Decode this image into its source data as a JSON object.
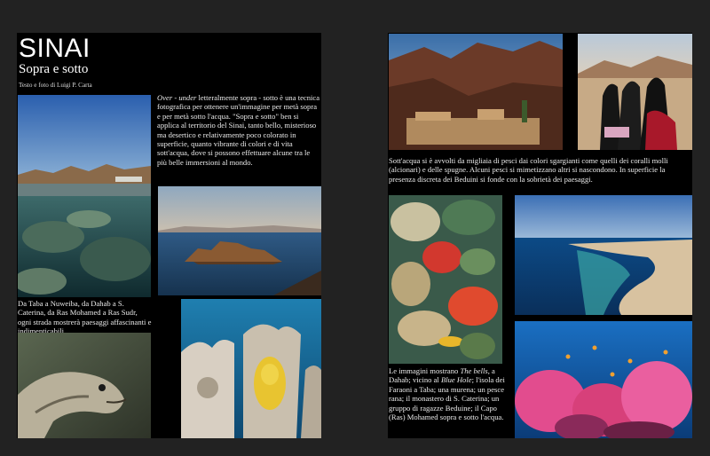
{
  "left_page": {
    "title": "SINAI",
    "subtitle": "Sopra e sotto",
    "byline": "Testo e foto di Luigi P. Carta",
    "intro_italic": "Over - under",
    "intro_text": " letteralmente sopra - sotto è una tecnica fotografica per ottenere un'immagine per metà sopra e per metà sotto l'acqua. \"Sopra e sotto\" ben si applica al territorio del Sinai, tanto bello, misterioso ma desertico e relativamente poco colorato in superficie, quanto vibrante di colori e di vita sott'acqua, dove si possono effettuare alcune tra le più belle immersioni al mondo.",
    "caption": "Da Taba a Nuweiba, da Dahab a S. Caterina, da Ras Mohamed a Ras Sudr, ogni strada mostrerà paesaggi affascinanti e indimenticabili"
  },
  "right_page": {
    "paragraph": "Sott'acqua si è avvolti da migliaia di pesci dai colori sgargianti come quelli dei coralli molli (alcionari) e delle spugne. Alcuni pesci si mimetizzano altri si nascondono. In superficie la presenza discreta dei Beduini si fonde con la sobrietà dei paesaggi.",
    "caption_pre": "Le immagini mostrano ",
    "caption_it1": "The bells",
    "caption_mid": ", a Dahab; vicino al ",
    "caption_it2": "Blue Hole",
    "caption_post": "; l'isola dei Faraoni a Taba; una murena; un pesce rana; il monastero di S. Caterina; un gruppo di ragazze Beduine; il Capo (Ras) Mohamed sopra e sotto l'acqua."
  },
  "colors": {
    "page_background": "#000000",
    "spread_background": "#222222",
    "text": "#eaeaea"
  }
}
